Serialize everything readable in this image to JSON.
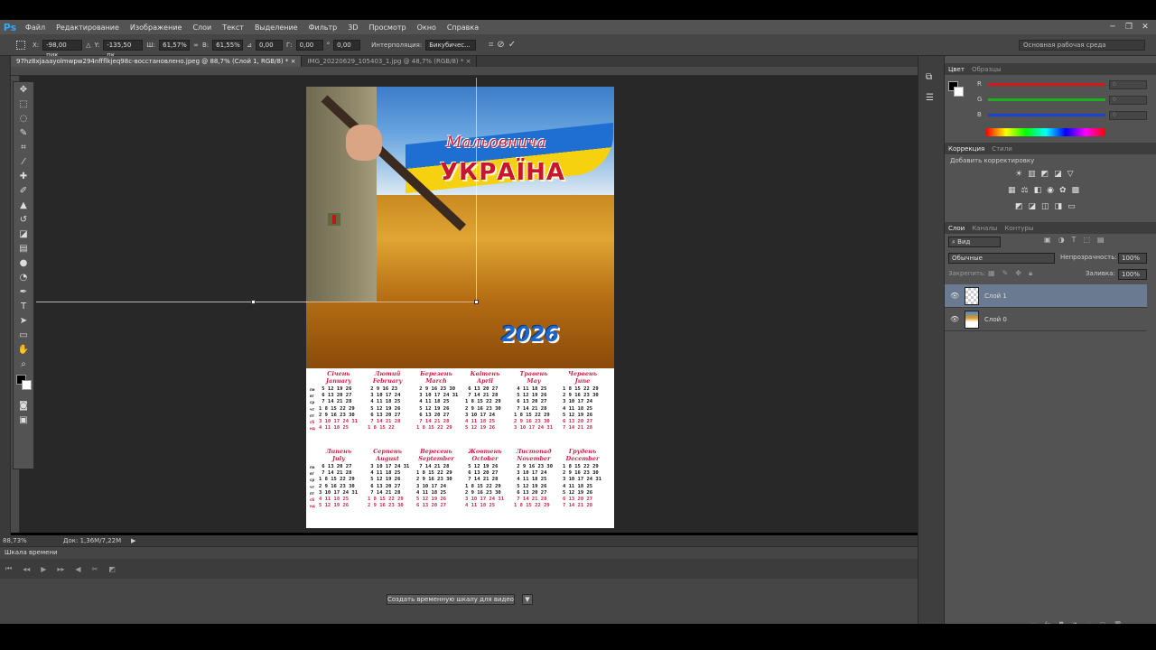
{
  "app": {
    "logo": "Ps"
  },
  "menu": [
    "Файл",
    "Редактирование",
    "Изображение",
    "Слои",
    "Текст",
    "Выделение",
    "Фильтр",
    "3D",
    "Просмотр",
    "Окно",
    "Справка"
  ],
  "window_controls": {
    "minimize": "─",
    "restore": "❐",
    "close": "✕"
  },
  "options": {
    "x_label": "X:",
    "x_value": "-98,00 пик",
    "y_label": "Y:",
    "y_value": "-135,50 пк",
    "w_label": "Ш:",
    "w_value": "61,57%",
    "h_label": "В:",
    "h_value": "61,55%",
    "angle_value": "0,00",
    "hskew_label": "Г:",
    "hskew_value": "0,00",
    "vskew_label": "°",
    "vskew_value": "0,00",
    "interp_label": "Интерполяция:",
    "interp_value": "Бикубичес...",
    "workspace": "Основная рабочая среда"
  },
  "tabs": [
    {
      "label": "97hz8xjaaayolmwpw294nffflkjeq98c-восстановлено.jpeg @ 88,7% (Слой 1, RGB/8) *",
      "close": "×"
    },
    {
      "label": "IMG_20220629_105403_1.jpg @ 48,7% (RGB/8) *",
      "close": "×"
    }
  ],
  "document": {
    "title_script": "Мальовнича",
    "title_main": "УКРАЇНА",
    "year": "2026",
    "day_labels": [
      "пн",
      "вт",
      "ср",
      "чт",
      "пт",
      "сб",
      "нд"
    ],
    "months_row1": [
      {
        "ua": "Січень",
        "en": "January",
        "rows": [
          " 5 12 19 26",
          " 6 13 20 27",
          " 7 14 21 28",
          "1 8 15 22 29",
          "2 9 16 23 30",
          "3 10 17 24 31",
          "4 11 18 25"
        ]
      },
      {
        "ua": "Лютий",
        "en": "February",
        "rows": [
          " 2 9 16 23",
          " 3 10 17 24",
          " 4 11 18 25",
          " 5 12 19 26",
          " 6 13 20 27",
          " 7 14 21 28",
          "1 8 15 22"
        ]
      },
      {
        "ua": "Березень",
        "en": "March",
        "rows": [
          " 2 9 16 23 30",
          " 3 10 17 24 31",
          " 4 11 18 25",
          " 5 12 19 26",
          " 6 13 20 27",
          " 7 14 21 28",
          "1 8 15 22 29"
        ]
      },
      {
        "ua": "Квітень",
        "en": "April",
        "rows": [
          " 6 13 20 27",
          " 7 14 21 28",
          "1 8 15 22 29",
          "2 9 16 23 30",
          "3 10 17 24",
          "4 11 18 25",
          "5 12 19 26"
        ]
      },
      {
        "ua": "Травень",
        "en": "May",
        "rows": [
          " 4 11 18 25",
          " 5 12 19 26",
          " 6 13 20 27",
          " 7 14 21 28",
          "1 8 15 22 29",
          "2 9 16 23 30",
          "3 10 17 24 31"
        ]
      },
      {
        "ua": "Червень",
        "en": "June",
        "rows": [
          "1 8 15 22 29",
          "2 9 16 23 30",
          "3 10 17 24",
          "4 11 18 25",
          "5 12 19 26",
          "6 13 20 27",
          "7 14 21 28"
        ]
      }
    ],
    "months_row2": [
      {
        "ua": "Липень",
        "en": "July",
        "rows": [
          " 6 13 20 27",
          " 7 14 21 28",
          "1 8 15 22 29",
          "2 9 16 23 30",
          "3 10 17 24 31",
          "4 11 18 25",
          "5 12 19 26"
        ]
      },
      {
        "ua": "Серпень",
        "en": "August",
        "rows": [
          " 3 10 17 24 31",
          " 4 11 18 25",
          " 5 12 19 26",
          " 6 13 20 27",
          " 7 14 21 28",
          "1 8 15 22 29",
          "2 9 16 23 30"
        ]
      },
      {
        "ua": "Вересень",
        "en": "September",
        "rows": [
          " 7 14 21 28",
          "1 8 15 22 29",
          "2 9 16 23 30",
          "3 10 17 24",
          "4 11 18 25",
          "5 12 19 26",
          "6 13 20 27"
        ]
      },
      {
        "ua": "Жовтень",
        "en": "October",
        "rows": [
          " 5 12 19 26",
          " 6 13 20 27",
          " 7 14 21 28",
          "1 8 15 22 29",
          "2 9 16 23 30",
          "3 10 17 24 31",
          "4 11 18 25"
        ]
      },
      {
        "ua": "Листопад",
        "en": "November",
        "rows": [
          " 2 9 16 23 30",
          " 3 10 17 24",
          " 4 11 18 25",
          " 5 12 19 26",
          " 6 13 20 27",
          " 7 14 21 28",
          "1 8 15 22 29"
        ]
      },
      {
        "ua": "Грудень",
        "en": "December",
        "rows": [
          "1 8 15 22 29",
          "2 9 16 23 30",
          "3 10 17 24 31",
          "4 11 18 25",
          "5 12 19 26",
          "6 13 20 27",
          "7 14 21 28"
        ]
      }
    ]
  },
  "status": {
    "zoom": "88,73%",
    "doc": "Док: 1,36M/7,22M"
  },
  "timeline": {
    "title": "Шкала времени",
    "create_button": "Создать временную шкалу для видео",
    "dropdown": "▼"
  },
  "color_panel": {
    "tab_active": "Цвет",
    "tab_inactive": "Образцы",
    "r": "R",
    "g": "G",
    "b": "B",
    "r_val": "0",
    "g_val": "0",
    "b_val": "0",
    "red": "#d41919",
    "green": "#19b419",
    "blue": "#1944d4"
  },
  "adjust_panel": {
    "tab_active": "Коррекция",
    "tab_inactive": "Стили",
    "hint": "Добавить корректировку"
  },
  "layers_panel": {
    "tab_active": "Слои",
    "tab_inactive1": "Каналы",
    "tab_inactive2": "Контуры",
    "kind": "Вид",
    "blend": "Обычные",
    "opacity_label": "Непрозрачность:",
    "opacity_value": "100%",
    "lock_label": "Закрепить:",
    "fill_label": "Заливка:",
    "fill_value": "100%",
    "layers": [
      {
        "name": "Слой 1"
      },
      {
        "name": "Слой 0"
      }
    ]
  }
}
